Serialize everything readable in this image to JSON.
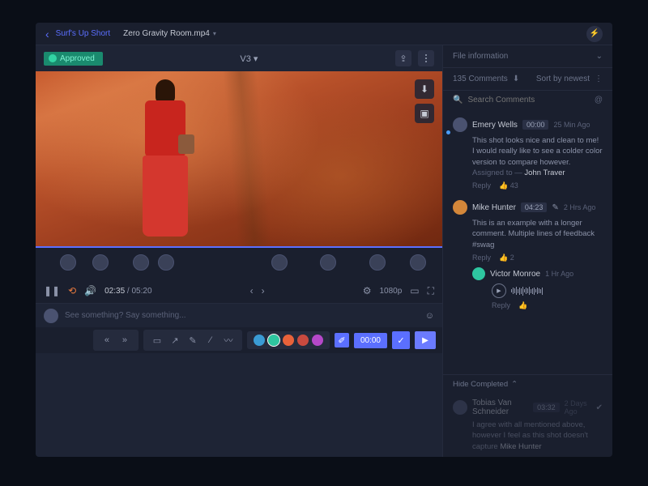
{
  "header": {
    "breadcrumb": "Surf's Up Short",
    "filename": "Zero Gravity Room.mp4"
  },
  "toolbar": {
    "status": "Approved",
    "version": "V3"
  },
  "controls": {
    "current": "02:35",
    "duration": "05:20",
    "quality": "1080p"
  },
  "comment_input": {
    "placeholder": "See something? Say something..."
  },
  "annotation": {
    "timecode": "00:00",
    "colors": [
      "#3a9bd4",
      "#2ec6a0",
      "#e8623a",
      "#c94a3f",
      "#b548c9"
    ]
  },
  "side": {
    "file_info": "File information",
    "count": "135 Comments",
    "sort": "Sort by newest",
    "search_placeholder": "Search Comments",
    "hide_completed": "Hide Completed"
  },
  "comments": [
    {
      "name": "Emery Wells",
      "tc": "00:00",
      "ago": "25 Min Ago",
      "body_pre": "This shot looks nice and clean to me! I would really like to see a colder color version to compare however. ",
      "assigned_label": "Assigned to — ",
      "assigned_to": "John Traver",
      "reply": "Reply",
      "likes": "43",
      "unread": true
    },
    {
      "name": "Mike Hunter",
      "tc": "04:23",
      "ago": "2 Hrs Ago",
      "body": "This is an example with a longer comment. Multiple lines of feedback #swag",
      "reply": "Reply",
      "likes": "2",
      "avatar_color": "#d4873a"
    },
    {
      "name": "Victor Monroe",
      "ago": "1 Hr Ago",
      "reply": "Reply",
      "avatar_color": "#2ec6a0",
      "is_audio_reply": true
    }
  ],
  "completed": {
    "name": "Tobias Van Schneider",
    "tc": "03:32",
    "ago": "2 Days Ago",
    "body_pre": "I agree with all mentioned above, however I feel as this shot doesn't capture ",
    "mention": "Mike Hunter"
  }
}
